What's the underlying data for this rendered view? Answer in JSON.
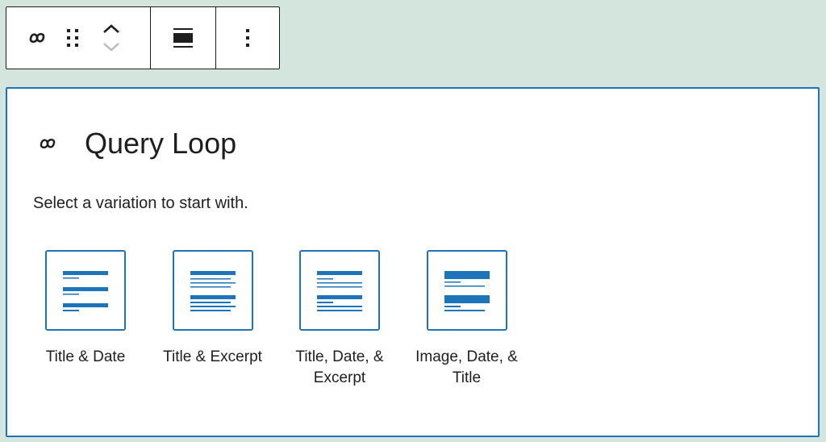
{
  "toolbar": {
    "block_type_icon": "query-loop-icon",
    "drag_handle_icon": "drag-handle-icon",
    "move_up_icon": "chevron-up-icon",
    "move_down_icon": "chevron-down-icon",
    "align_icon": "align-full-width-icon",
    "options_icon": "more-vertical-icon"
  },
  "block": {
    "icon": "query-loop-icon",
    "title": "Query Loop",
    "instructions": "Select a variation to start with.",
    "accent_color": "#1e74b9",
    "variations": [
      {
        "label": "Title & Date",
        "icon": "title-date-icon"
      },
      {
        "label": "Title & Excerpt",
        "icon": "title-excerpt-icon"
      },
      {
        "label": "Title, Date, & Excerpt",
        "icon": "title-date-excerpt-icon"
      },
      {
        "label": "Image, Date, & Title",
        "icon": "image-date-title-icon"
      }
    ]
  }
}
